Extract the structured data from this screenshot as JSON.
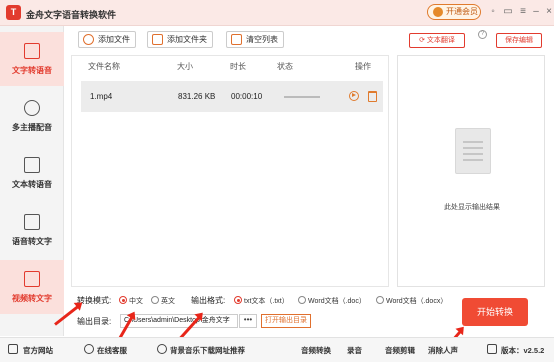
{
  "app": {
    "logo_text": "T",
    "title": "金舟文字语音转换软件",
    "vip_label": "开通会员"
  },
  "titlebar_icons": [
    "user-icon",
    "message-icon",
    "menu-icon",
    "minimize-icon",
    "close-icon"
  ],
  "sidebar": {
    "items": [
      {
        "label": "文字转语音",
        "icon": "text-to-speech-icon",
        "active": true
      },
      {
        "label": "多主播配音",
        "icon": "multi-voice-icon",
        "active": false
      },
      {
        "label": "文本转语音",
        "icon": "document-to-speech-icon",
        "active": false
      },
      {
        "label": "语音转文字",
        "icon": "speech-to-text-icon",
        "active": false
      },
      {
        "label": "视频转文字",
        "icon": "video-to-text-icon",
        "active": true
      }
    ]
  },
  "toolbar": {
    "add_file": "添加文件",
    "add_folder": "添加文件夹",
    "clear_list": "清空列表",
    "text_translate": "文本翻译",
    "save_edit": "保存编辑",
    "help": "?"
  },
  "table": {
    "headers": [
      "文件名称",
      "大小",
      "时长",
      "状态",
      "操作"
    ],
    "rows": [
      {
        "name": "1.mp4",
        "size": "831.26 KB",
        "duration": "00:00:10",
        "status": ""
      }
    ]
  },
  "preview": {
    "text": "此处显示输出结果"
  },
  "settings": {
    "mode_label": "转换模式:",
    "mode_options": [
      "中文",
      "英文"
    ],
    "mode_selected": "中文",
    "format_label": "输出格式:",
    "format_options": [
      "txt文本（.txt）",
      "Word文档（.doc）",
      "Word文档（.docx）"
    ],
    "format_selected": "txt文本（.txt）",
    "output_label": "输出目录:",
    "output_path": "C:\\Users\\admin\\Desktop\\金舟文字",
    "browse_label": "•••",
    "open_output": "打开输出目录",
    "start": "开始转换"
  },
  "statusbar": {
    "official_site": "官方网站",
    "customer_service": "在线客服",
    "bgm_link": "背景音乐下载网址推荐",
    "audio_convert": "音频转换",
    "record": "录音",
    "audio_edit": "音频剪辑",
    "vocal_remove": "消除人声",
    "version": "版本：v2.5.2"
  },
  "colors": {
    "accent": "#e23b2e",
    "orange": "#e0702e",
    "start_button": "#f04b34",
    "annotation_arrow": "#e8261a"
  }
}
